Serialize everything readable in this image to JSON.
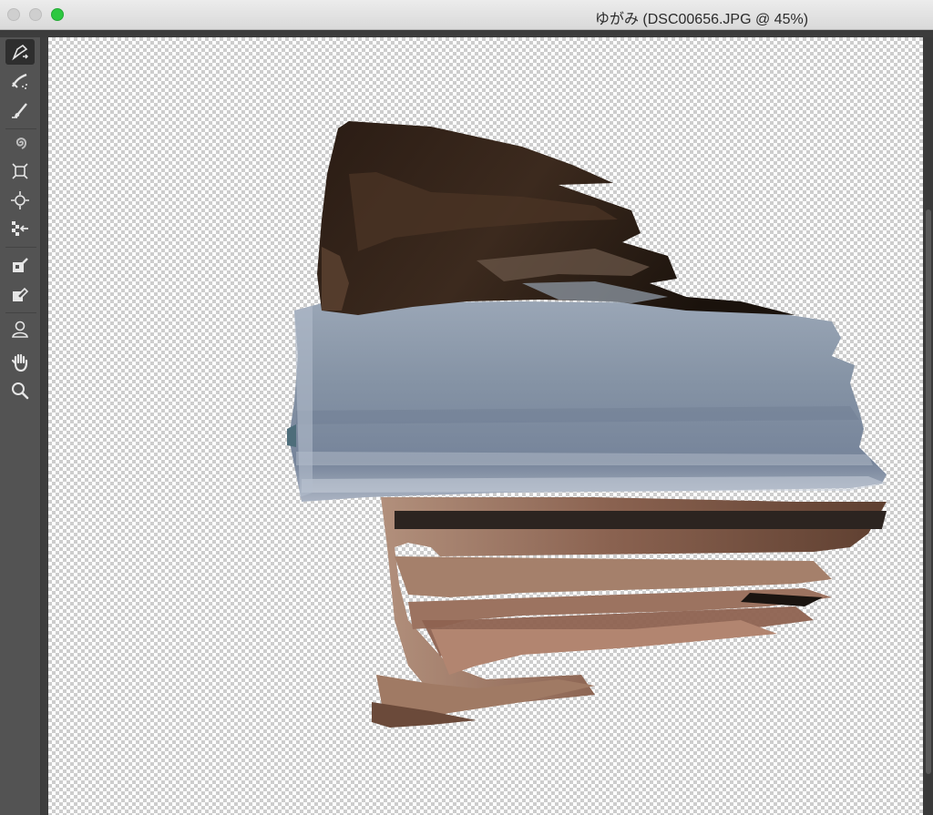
{
  "window": {
    "title": "ゆがみ (DSC00656.JPG @ 45%)"
  },
  "toolbar": {
    "tools": [
      {
        "icon": "forward-warp-tool-icon",
        "active": true
      },
      {
        "icon": "reconstruct-tool-icon"
      },
      {
        "icon": "smooth-tool-icon"
      },
      {
        "icon": "twirl-clockwise-tool-icon"
      },
      {
        "icon": "pucker-tool-icon"
      },
      {
        "icon": "bloat-tool-icon"
      },
      {
        "icon": "push-left-tool-icon"
      },
      {
        "icon": "freeze-mask-tool-icon"
      },
      {
        "icon": "thaw-mask-tool-icon"
      },
      {
        "icon": "face-tool-icon"
      },
      {
        "icon": "hand-tool-icon"
      },
      {
        "icon": "zoom-tool-icon"
      }
    ]
  },
  "colors": {
    "titlebar": "#e3e3e3",
    "panel": "#535353",
    "zoom_button": "#2dc840"
  }
}
